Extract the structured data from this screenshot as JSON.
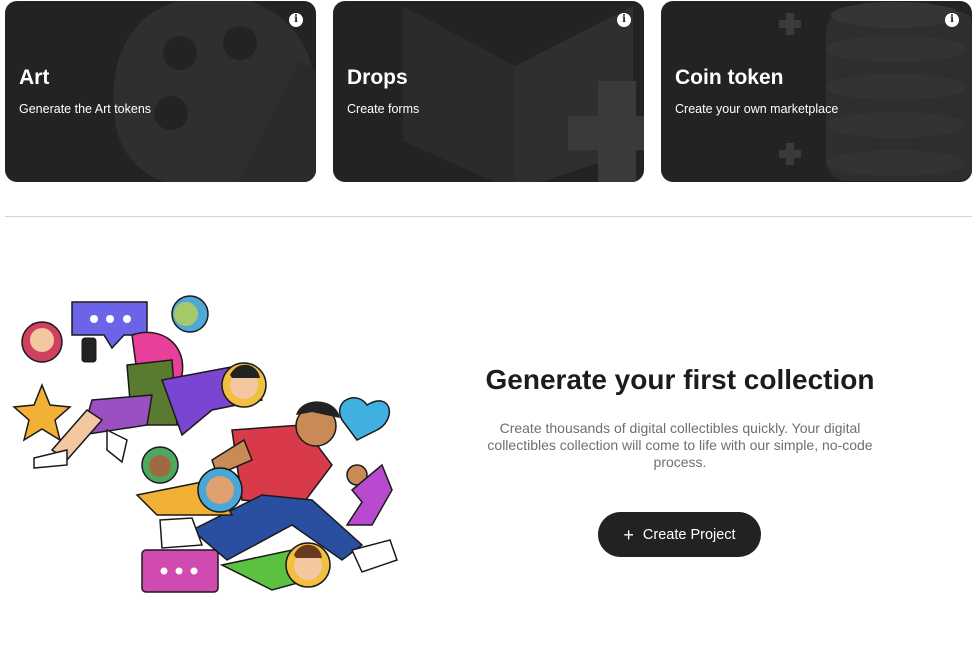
{
  "cards": [
    {
      "title": "Art",
      "subtitle": "Generate the Art tokens",
      "background_icon": "palette-icon"
    },
    {
      "title": "Drops",
      "subtitle": "Create forms",
      "background_icon": "book-plus-icon"
    },
    {
      "title": "Coin token",
      "subtitle": "Create your own marketplace",
      "background_icon": "coins-icon"
    }
  ],
  "info_icon_glyph": "i",
  "empty_state": {
    "title": "Generate your first collection",
    "description": "Create thousands of digital collectibles quickly. Your digital collectibles collection will come to life with our simple, no-code process.",
    "button_icon": "+",
    "button_label": "Create Project"
  },
  "colors": {
    "card_background": "#232323",
    "button_background": "#222222",
    "divider": "#d4d4d4",
    "description_text": "#6f6f6f"
  }
}
